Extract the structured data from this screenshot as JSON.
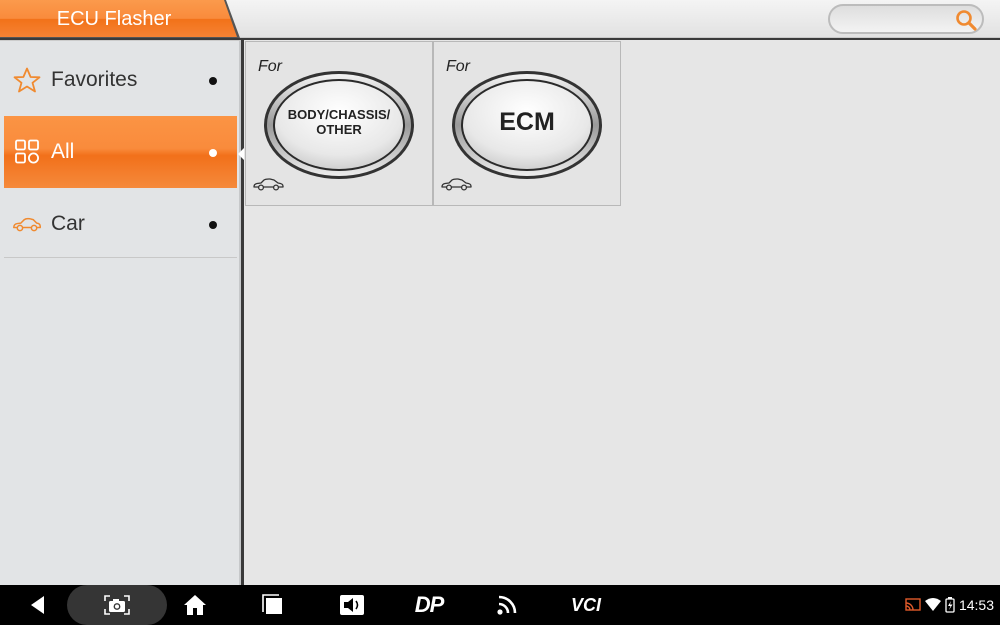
{
  "app": {
    "title": "ECU Flasher"
  },
  "search": {
    "placeholder": "",
    "icon": "search-icon"
  },
  "sidebar": {
    "items": [
      {
        "label": "Favorites",
        "icon": "star-icon",
        "active": false
      },
      {
        "label": "All",
        "icon": "grid-icon",
        "active": true
      },
      {
        "label": "Car",
        "icon": "car-icon",
        "active": false
      }
    ]
  },
  "tiles": [
    {
      "prefix": "For",
      "badge": "BODY/CHASSIS/ OTHER",
      "icon": "car-icon"
    },
    {
      "prefix": "For",
      "badge": "ECM",
      "icon": "car-icon"
    }
  ],
  "navbar": {
    "buttons": [
      "back-icon",
      "screenshot-icon",
      "home-icon",
      "recent-apps-icon",
      "volume-icon",
      "dp-icon",
      "wifi-signal-icon",
      "vci-icon"
    ],
    "dp_label": "DP",
    "vci_label": "VCI"
  },
  "status_bar": {
    "time": "14:53"
  },
  "colors": {
    "accent": "#f98b3c",
    "accent_dark": "#f2701a",
    "icon_orange": "#f08a30"
  }
}
